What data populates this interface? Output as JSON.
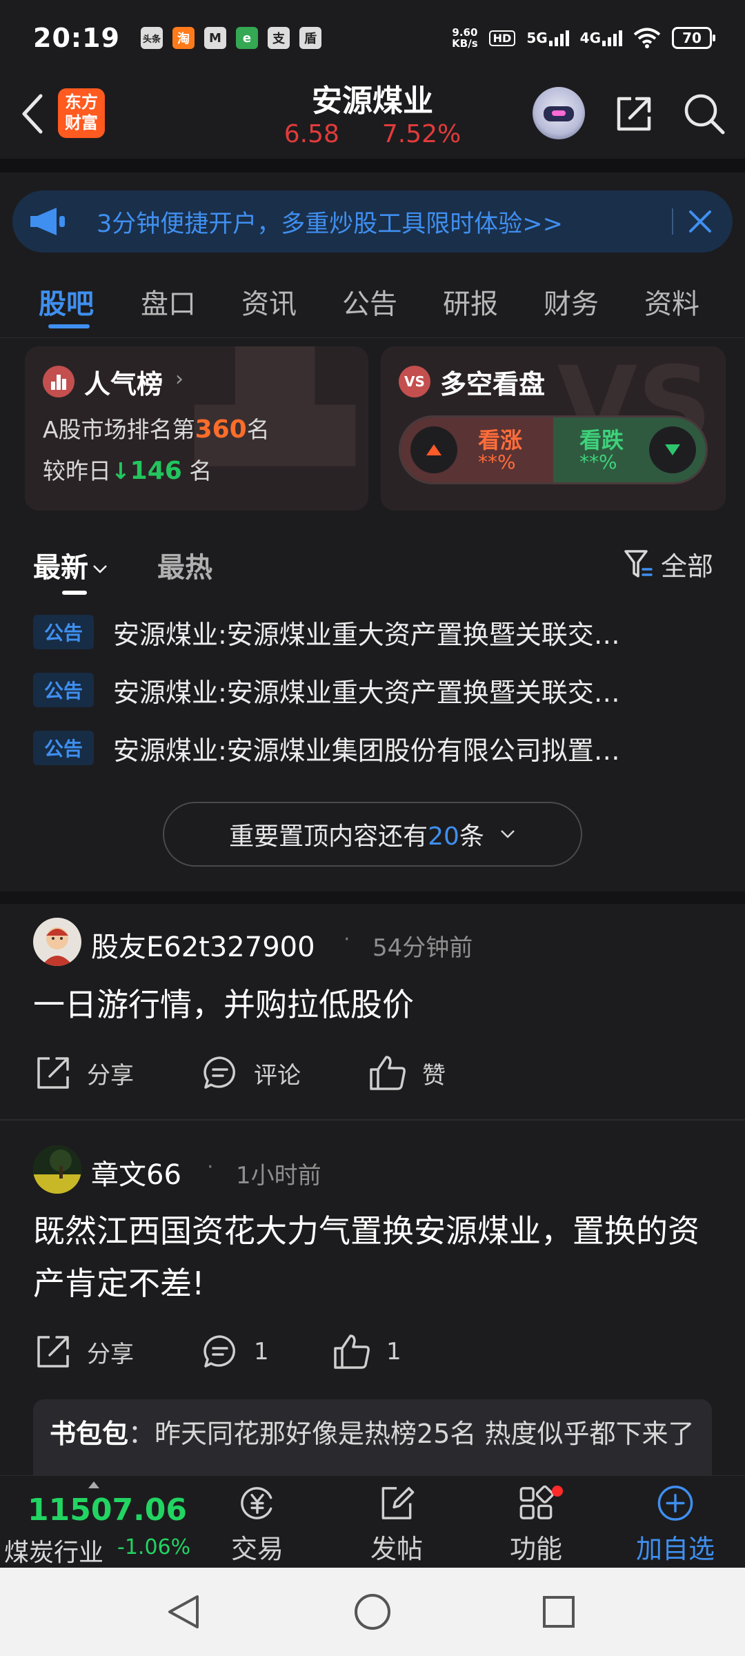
{
  "status_bar": {
    "time": "20:19",
    "apps": [
      "头条",
      "淘",
      "M",
      "e",
      "支",
      "盾"
    ],
    "net_speed_value": "9.60",
    "net_speed_unit": "KB/s",
    "hd_label": "HD",
    "sim1_label": "5G",
    "sim2_label": "4G",
    "battery": "70"
  },
  "header": {
    "logo_line1": "东方",
    "logo_line2": "财富",
    "stock_name": "安源煤业",
    "price": "6.58",
    "change_pct": "7.52%"
  },
  "banner": {
    "text": "3分钟便捷开户，多重炒股工具限时体验>>"
  },
  "tabs": [
    {
      "label": "股吧"
    },
    {
      "label": "盘口"
    },
    {
      "label": "资讯"
    },
    {
      "label": "公告"
    },
    {
      "label": "研报"
    },
    {
      "label": "财务"
    },
    {
      "label": "资料"
    }
  ],
  "popularity": {
    "title": "人气榜",
    "rank_prefix": "A股市场排名第",
    "rank": "360",
    "rank_suffix": "名",
    "change_prefix": "较昨日",
    "change": "146",
    "change_suffix": " 名"
  },
  "sentiment": {
    "title": "多空看盘",
    "up_label": "看涨",
    "up_pct": "**%",
    "down_label": "看跌",
    "down_pct": "**%"
  },
  "filter": {
    "latest": "最新",
    "hot": "最热",
    "all": "全部"
  },
  "notices": [
    {
      "badge": "公告",
      "text": "安源煤业:安源煤业重大资产置换暨关联交…"
    },
    {
      "badge": "公告",
      "text": "安源煤业:安源煤业重大资产置换暨关联交…"
    },
    {
      "badge": "公告",
      "text": "安源煤业:安源煤业集团股份有限公司拟置…"
    }
  ],
  "pinned": {
    "prefix": "重要置顶内容还有",
    "count": "20",
    "suffix": "条"
  },
  "posts": [
    {
      "author": "股友E62t327900",
      "time": "54分钟前",
      "body": "一日游行情，并购拉低股价",
      "share": "分享",
      "comment": "评论",
      "like": "赞"
    },
    {
      "author": "章文66",
      "time": "1小时前",
      "body": "既然江西国资花大力气置换安源煤业，置换的资产肯定不差!",
      "share": "分享",
      "comment": "1",
      "like": "1"
    }
  ],
  "comment_preview": {
    "user": "书包包",
    "text": "：昨天同花那好像是热榜25名  热度似乎都下来了"
  },
  "bottom_nav": {
    "index_value": "11507.06",
    "index_name": "煤炭行业",
    "index_change": "-1.06%",
    "trade": "交易",
    "post": "发帖",
    "features": "功能",
    "add_watch": "加自选"
  },
  "colors": {
    "accent_blue": "#3f8ff0",
    "up_red": "#e23b3b",
    "down_green": "#22d462",
    "rank_orange": "#ff6d2a"
  }
}
